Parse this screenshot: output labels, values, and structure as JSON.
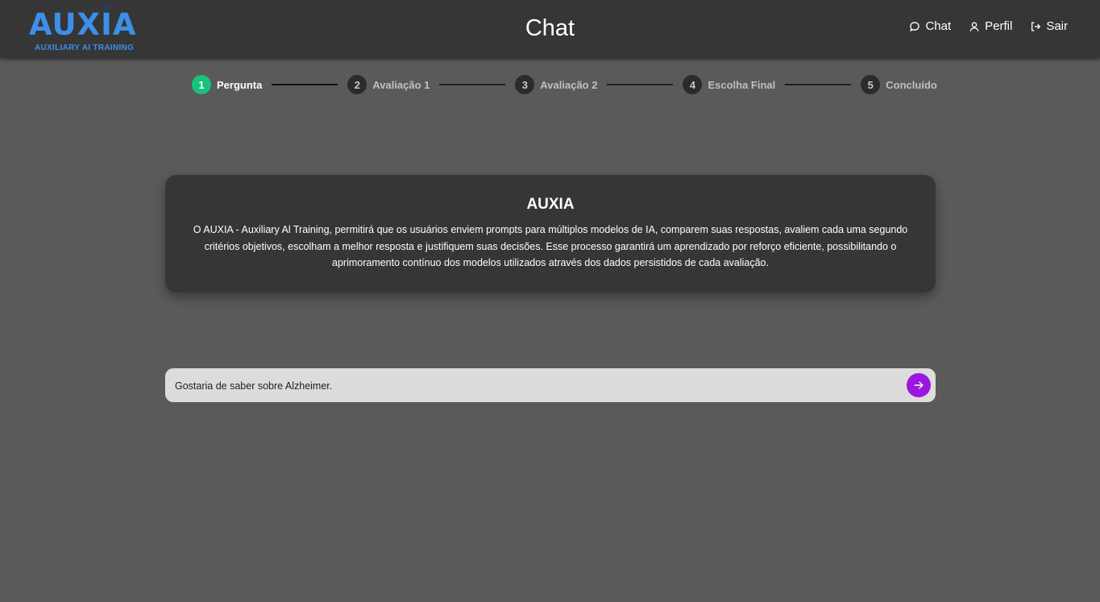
{
  "header": {
    "logo_text": "AUXIA",
    "logo_subtitle": "AUXILIARY AI TRAINING",
    "title": "Chat",
    "nav": [
      {
        "label": "Chat",
        "icon": "chat-bubble-icon"
      },
      {
        "label": "Perfil",
        "icon": "user-icon"
      },
      {
        "label": "Sair",
        "icon": "logout-icon"
      }
    ]
  },
  "stepper": {
    "steps": [
      {
        "number": "1",
        "label": "Pergunta",
        "active": true
      },
      {
        "number": "2",
        "label": "Avaliação 1",
        "active": false
      },
      {
        "number": "3",
        "label": "Avaliação 2",
        "active": false
      },
      {
        "number": "4",
        "label": "Escolha Final",
        "active": false
      },
      {
        "number": "5",
        "label": "Concluído",
        "active": false
      }
    ]
  },
  "info_card": {
    "title": "AUXIA",
    "text": "O AUXIA - Auxiliary Al Training, permitirá que os usuários enviem prompts para múltiplos modelos de IA, comparem suas respostas, avaliem cada uma segundo critérios objetivos, escolham a melhor resposta e justifiquem suas decisões. Esse processo garantirá um aprendizado por reforço eficiente, possibilitando o aprimoramento contínuo dos modelos utilizados através dos dados persistidos de cada avaliação."
  },
  "chat": {
    "input_value": "Gostaria de saber sobre Alzheimer.",
    "send_icon": "arrow-right-icon"
  },
  "colors": {
    "background": "#5a5a5a",
    "header_bg": "#363636",
    "brand_blue": "#3d8fe8",
    "step_active": "#19c27a",
    "send_button": "#9b17dd"
  }
}
